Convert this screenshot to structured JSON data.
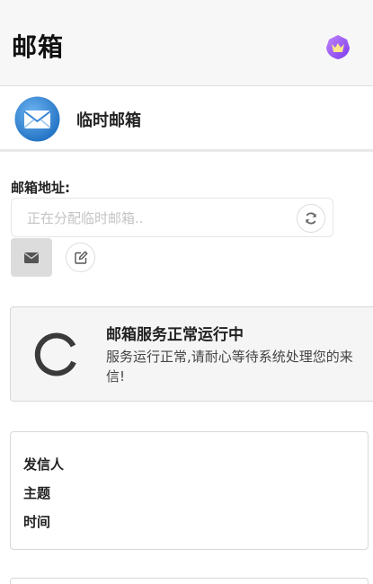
{
  "header": {
    "title": "邮箱",
    "vip_icon": "crown-shield-icon",
    "vip_color": "#8b5cf6"
  },
  "app": {
    "name": "临时邮箱",
    "icon": "envelope-icon"
  },
  "address": {
    "label": "邮箱地址:",
    "value": "",
    "placeholder": "正在分配临时邮箱.."
  },
  "actions": {
    "refresh_icon": "refresh-icon",
    "mail_icon": "envelope-icon",
    "edit_icon": "edit-icon"
  },
  "status": {
    "title": "邮箱服务正常运行中",
    "description": "服务运行正常,请耐心等待系统处理您的来信!"
  },
  "mail_fields": {
    "sender": "发信人",
    "subject": "主题",
    "time": "时间"
  }
}
